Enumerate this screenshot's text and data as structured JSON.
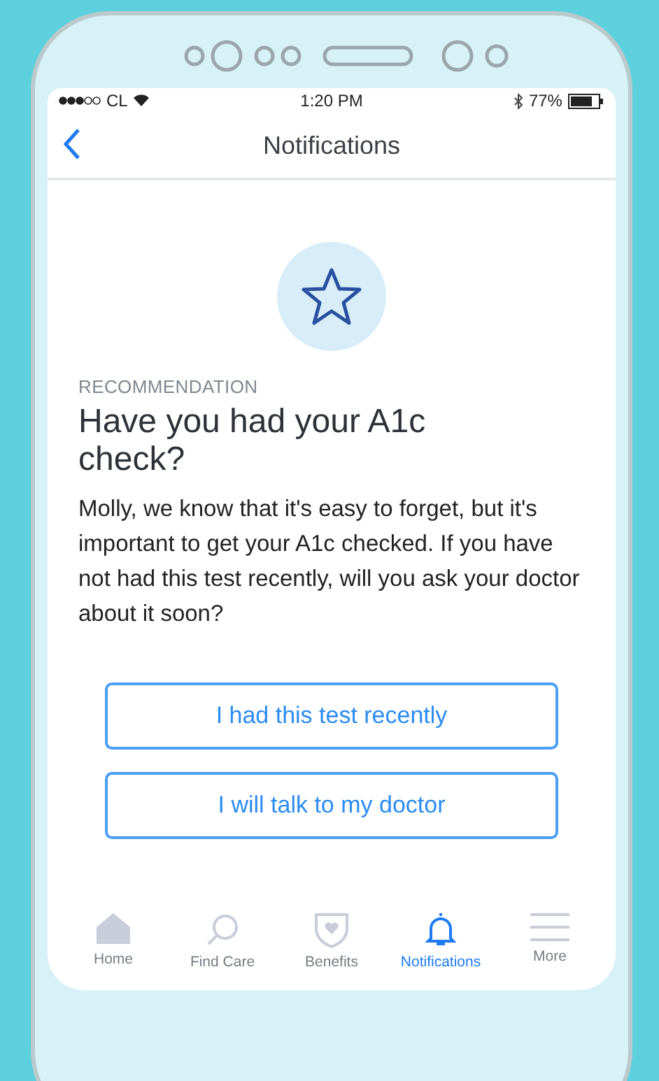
{
  "status_bar": {
    "carrier": "CL",
    "time": "1:20 PM",
    "battery": "77%"
  },
  "nav_bar": {
    "title": "Notifications"
  },
  "card": {
    "eyebrow": "RECOMMENDATION",
    "title": "Have you had your A1c check?",
    "body": "Molly, we know that it's easy to forget, but it's important to get your A1c checked. If you have not had this test recently, will you ask your doctor about it soon?"
  },
  "buttons": [
    "I had this test recently",
    "I will talk to my doctor"
  ],
  "tabs": [
    {
      "label": "Home",
      "kind": "home",
      "selected": false
    },
    {
      "label": "Find Care",
      "kind": "search",
      "selected": false
    },
    {
      "label": "Benefits",
      "kind": "shield",
      "selected": false
    },
    {
      "label": "Notifications",
      "kind": "bell",
      "selected": true
    },
    {
      "label": "More",
      "kind": "menu",
      "selected": false
    }
  ]
}
